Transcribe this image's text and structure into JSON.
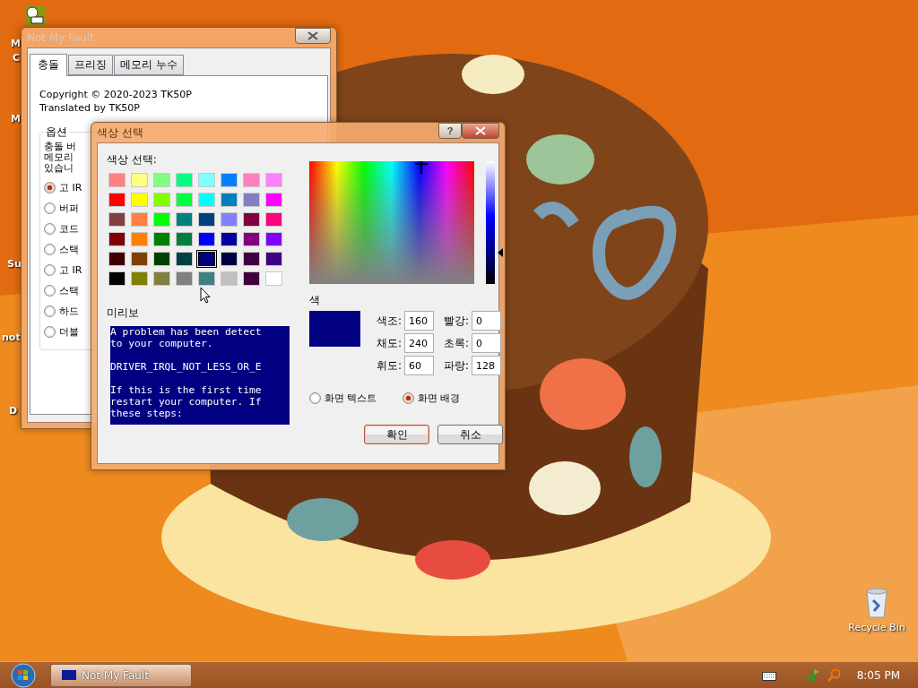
{
  "desktop": {
    "icon_labels": [
      {
        "label": "M"
      },
      {
        "label": "C"
      },
      {
        "label": "M"
      },
      {
        "label": "Su"
      },
      {
        "label": "not"
      },
      {
        "label": "D"
      }
    ],
    "recycle_bin": {
      "label": "Recycle Bin"
    }
  },
  "main_window": {
    "title": "Not My Fault",
    "tabs": [
      {
        "label": "충돌",
        "selected": true
      },
      {
        "label": "프리징",
        "selected": false
      },
      {
        "label": "메모리 누수",
        "selected": false
      }
    ],
    "copyright": "Copyright © 2020-2023 TK50P",
    "translated": "Translated by TK50P",
    "options": {
      "title": "옵션",
      "description": [
        "충돌 버",
        "메모리",
        "있습니"
      ],
      "radios": [
        {
          "label": "고 IR",
          "selected": true
        },
        {
          "label": "버퍼",
          "selected": false
        },
        {
          "label": "코드",
          "selected": false
        },
        {
          "label": "스택",
          "selected": false
        },
        {
          "label": "고 IR",
          "selected": false
        },
        {
          "label": "스택",
          "selected": false
        },
        {
          "label": "하드",
          "selected": false
        },
        {
          "label": "더블",
          "selected": false
        }
      ]
    }
  },
  "color_dialog": {
    "title": "색상 선택",
    "help": "?",
    "basic_label": "색상 선택:",
    "swatches": [
      {
        "color": "#ff8080",
        "selected": false
      },
      {
        "color": "#ffff80",
        "selected": false
      },
      {
        "color": "#80ff80",
        "selected": false
      },
      {
        "color": "#00ff80",
        "selected": false
      },
      {
        "color": "#80ffff",
        "selected": false
      },
      {
        "color": "#0080ff",
        "selected": false
      },
      {
        "color": "#ff80c0",
        "selected": false
      },
      {
        "color": "#ff80ff",
        "selected": false
      },
      {
        "color": "#ff0000",
        "selected": false
      },
      {
        "color": "#ffff00",
        "selected": false
      },
      {
        "color": "#80ff00",
        "selected": false
      },
      {
        "color": "#00ff40",
        "selected": false
      },
      {
        "color": "#00ffff",
        "selected": false
      },
      {
        "color": "#0080c0",
        "selected": false
      },
      {
        "color": "#8080c0",
        "selected": false
      },
      {
        "color": "#ff00ff",
        "selected": false
      },
      {
        "color": "#804040",
        "selected": false
      },
      {
        "color": "#ff8040",
        "selected": false
      },
      {
        "color": "#00ff00",
        "selected": false
      },
      {
        "color": "#008080",
        "selected": false
      },
      {
        "color": "#004080",
        "selected": false
      },
      {
        "color": "#8080ff",
        "selected": false
      },
      {
        "color": "#800040",
        "selected": false
      },
      {
        "color": "#ff0080",
        "selected": false
      },
      {
        "color": "#800000",
        "selected": false
      },
      {
        "color": "#ff8000",
        "selected": false
      },
      {
        "color": "#008000",
        "selected": false
      },
      {
        "color": "#008040",
        "selected": false
      },
      {
        "color": "#0000ff",
        "selected": false
      },
      {
        "color": "#0000a0",
        "selected": false
      },
      {
        "color": "#800080",
        "selected": false
      },
      {
        "color": "#8000ff",
        "selected": false
      },
      {
        "color": "#400000",
        "selected": false
      },
      {
        "color": "#804000",
        "selected": false
      },
      {
        "color": "#004000",
        "selected": false
      },
      {
        "color": "#004040",
        "selected": false
      },
      {
        "color": "#000080",
        "selected": true
      },
      {
        "color": "#000040",
        "selected": false
      },
      {
        "color": "#400040",
        "selected": false
      },
      {
        "color": "#400080",
        "selected": false
      },
      {
        "color": "#000000",
        "selected": false
      },
      {
        "color": "#808000",
        "selected": false
      },
      {
        "color": "#808040",
        "selected": false
      },
      {
        "color": "#808080",
        "selected": false
      },
      {
        "color": "#408080",
        "selected": false
      },
      {
        "color": "#c0c0c0",
        "selected": false
      },
      {
        "color": "#400040",
        "selected": false
      },
      {
        "color": "#ffffff",
        "selected": false
      }
    ],
    "preview_label": "미리보",
    "preview_paragraphs": [
      "A problem has been detect\nto your computer.",
      "DRIVER_IRQL_NOT_LESS_OR_E",
      "If this is the first time\nrestart your computer. If\nthese steps:"
    ],
    "color_label": "색",
    "fields": [
      {
        "label": "색조:",
        "value": "160"
      },
      {
        "label": "빨강:",
        "value": "0"
      },
      {
        "label": "채도:",
        "value": "240"
      },
      {
        "label": "초록:",
        "value": "0"
      },
      {
        "label": "휘도:",
        "value": "60"
      },
      {
        "label": "파랑:",
        "value": "128"
      }
    ],
    "targets": [
      {
        "label": "화면 텍스트",
        "selected": false
      },
      {
        "label": "화면 배경",
        "selected": true
      }
    ],
    "buttons": [
      {
        "label": "확인",
        "default": true
      },
      {
        "label": "취소",
        "default": false
      }
    ]
  },
  "taskbar": {
    "tasks": [
      {
        "label": "Not My Fault"
      }
    ],
    "clock": "8:05 PM"
  }
}
